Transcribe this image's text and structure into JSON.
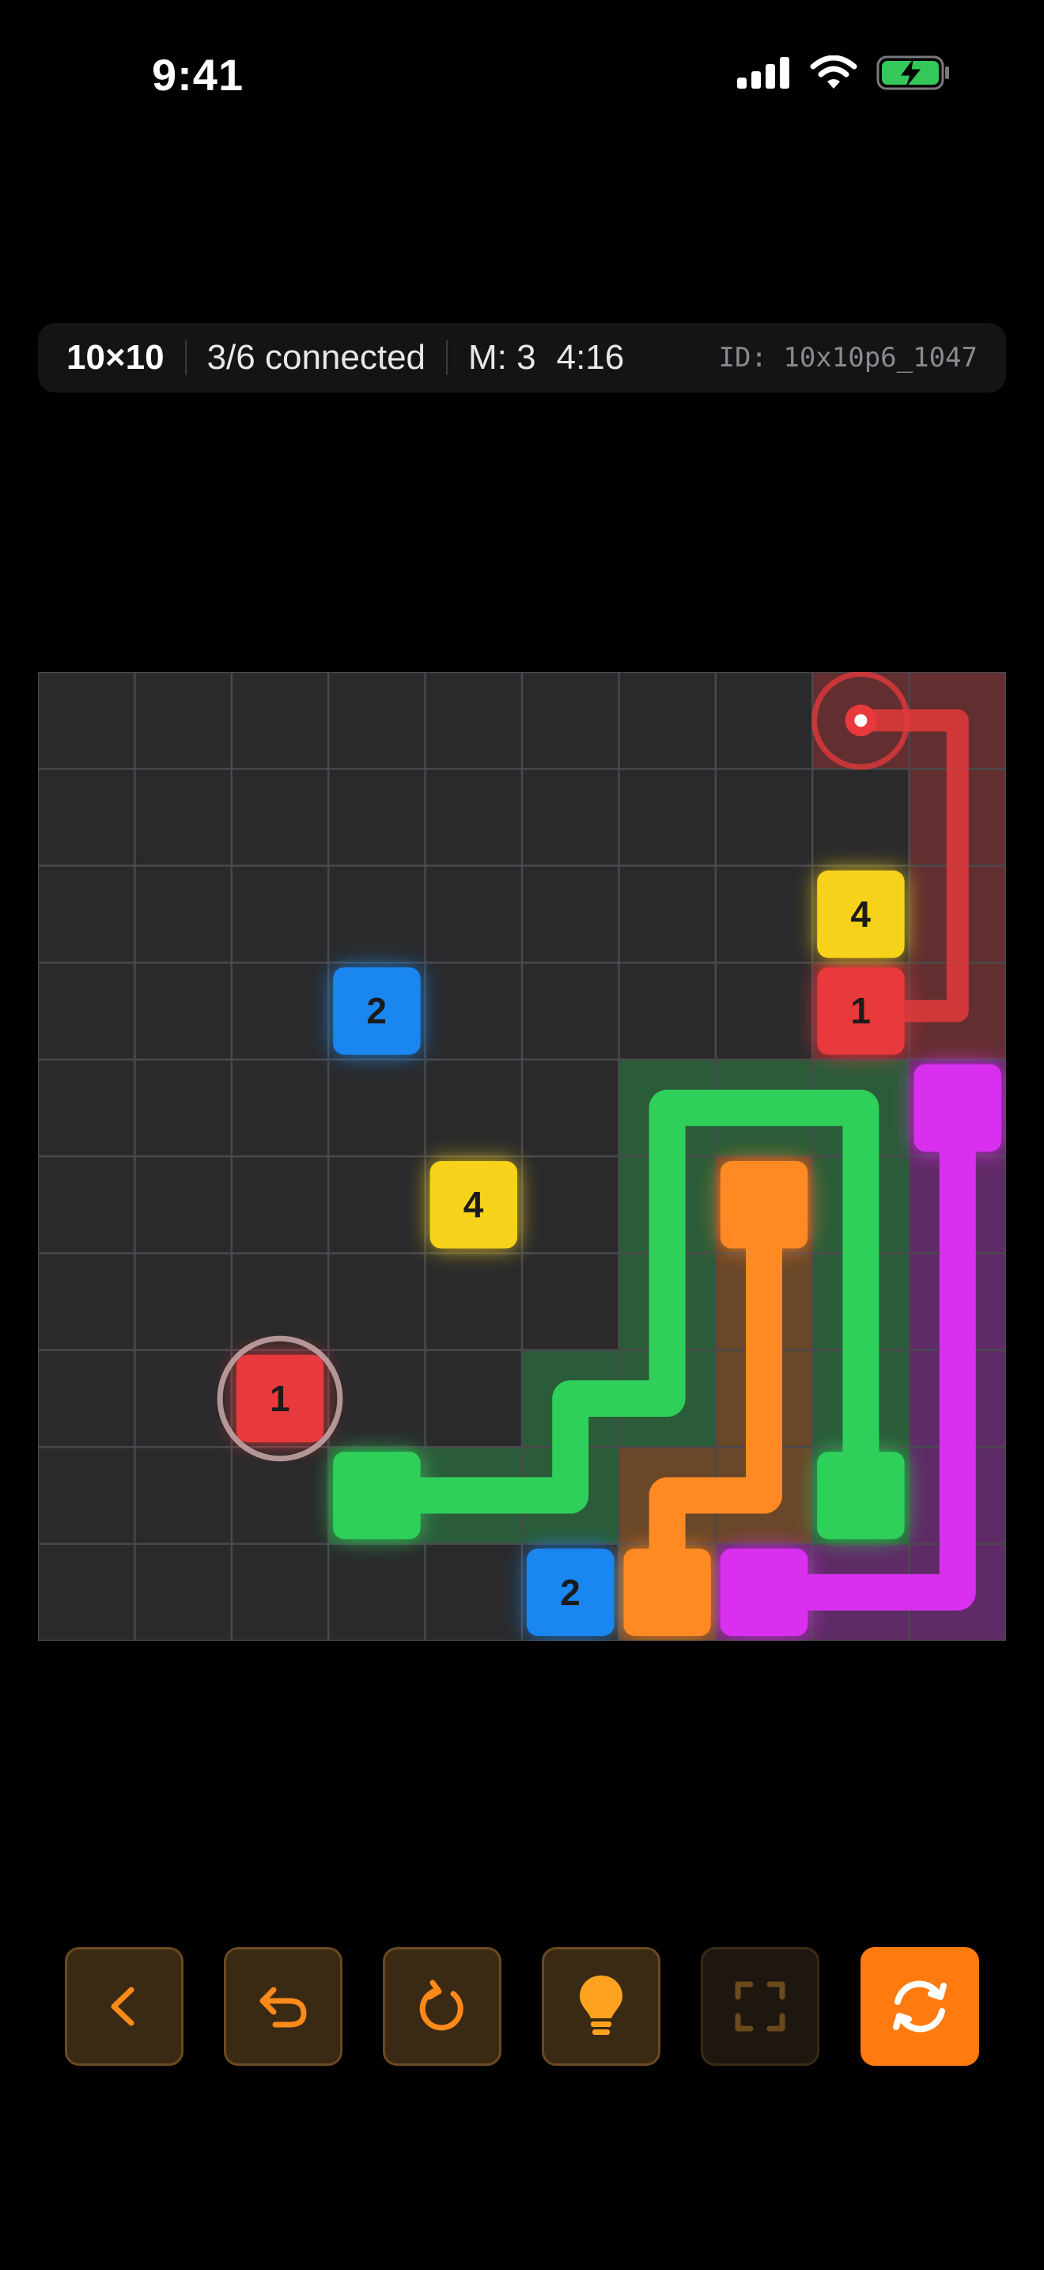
{
  "status_bar": {
    "time": "9:41"
  },
  "info_bar": {
    "size": "10×10",
    "connected": "3/6 connected",
    "moves": "M: 3",
    "timer": "4:16",
    "puzzle_id": "ID: 10x10p6_1047"
  },
  "colors": {
    "red": "#e8393c",
    "yellow": "#f6d21b",
    "blue": "#1a86f0",
    "green": "#2fd05a",
    "orange": "#ff8a24",
    "magenta": "#d930ef",
    "accent": "#ff7a0f"
  },
  "grid": {
    "rows": 10,
    "cols": 10,
    "dots": [
      {
        "color": "red",
        "label": "1",
        "row": 3,
        "col": 8
      },
      {
        "color": "red",
        "label": "1",
        "row": 7,
        "col": 2,
        "selected": true
      },
      {
        "color": "yellow",
        "label": "4",
        "row": 2,
        "col": 8
      },
      {
        "color": "yellow",
        "label": "4",
        "row": 5,
        "col": 4
      },
      {
        "color": "blue",
        "label": "2",
        "row": 3,
        "col": 3
      },
      {
        "color": "blue",
        "label": "2",
        "row": 9,
        "col": 5
      },
      {
        "color": "green",
        "label": "",
        "row": 8,
        "col": 3
      },
      {
        "color": "green",
        "label": "",
        "row": 8,
        "col": 8
      },
      {
        "color": "orange",
        "label": "",
        "row": 5,
        "col": 7
      },
      {
        "color": "orange",
        "label": "",
        "row": 9,
        "col": 6
      },
      {
        "color": "magenta",
        "label": "",
        "row": 4,
        "col": 9
      },
      {
        "color": "magenta",
        "label": "",
        "row": 9,
        "col": 7
      }
    ],
    "paths": [
      {
        "color": "red",
        "cells": [
          [
            0,
            8
          ],
          [
            0,
            9
          ],
          [
            1,
            9
          ],
          [
            2,
            9
          ],
          [
            3,
            9
          ],
          [
            3,
            8
          ]
        ],
        "active": true,
        "cursor": [
          0,
          8
        ]
      },
      {
        "color": "green",
        "cells": [
          [
            8,
            3
          ],
          [
            8,
            4
          ],
          [
            8,
            5
          ],
          [
            7,
            5
          ],
          [
            7,
            6
          ],
          [
            6,
            6
          ],
          [
            5,
            6
          ],
          [
            4,
            6
          ],
          [
            4,
            7
          ],
          [
            4,
            8
          ],
          [
            5,
            8
          ],
          [
            6,
            8
          ],
          [
            7,
            8
          ],
          [
            8,
            8
          ]
        ]
      },
      {
        "color": "orange",
        "cells": [
          [
            5,
            7
          ],
          [
            6,
            7
          ],
          [
            7,
            7
          ],
          [
            8,
            7
          ],
          [
            8,
            6
          ],
          [
            9,
            6
          ]
        ]
      },
      {
        "color": "magenta",
        "cells": [
          [
            4,
            9
          ],
          [
            5,
            9
          ],
          [
            6,
            9
          ],
          [
            7,
            9
          ],
          [
            8,
            9
          ],
          [
            9,
            9
          ],
          [
            9,
            8
          ],
          [
            9,
            7
          ]
        ]
      }
    ]
  },
  "toolbar": {
    "buttons": [
      {
        "name": "back-button",
        "icon": "chevron-left-icon"
      },
      {
        "name": "undo-button",
        "icon": "undo-arrow-icon"
      },
      {
        "name": "restart-button",
        "icon": "restart-icon"
      },
      {
        "name": "hint-button",
        "icon": "lightbulb-icon"
      },
      {
        "name": "fullscreen-button",
        "icon": "fullscreen-icon",
        "disabled": true
      },
      {
        "name": "new-puzzle-button",
        "icon": "refresh-cycle-icon",
        "primary": true
      }
    ]
  }
}
